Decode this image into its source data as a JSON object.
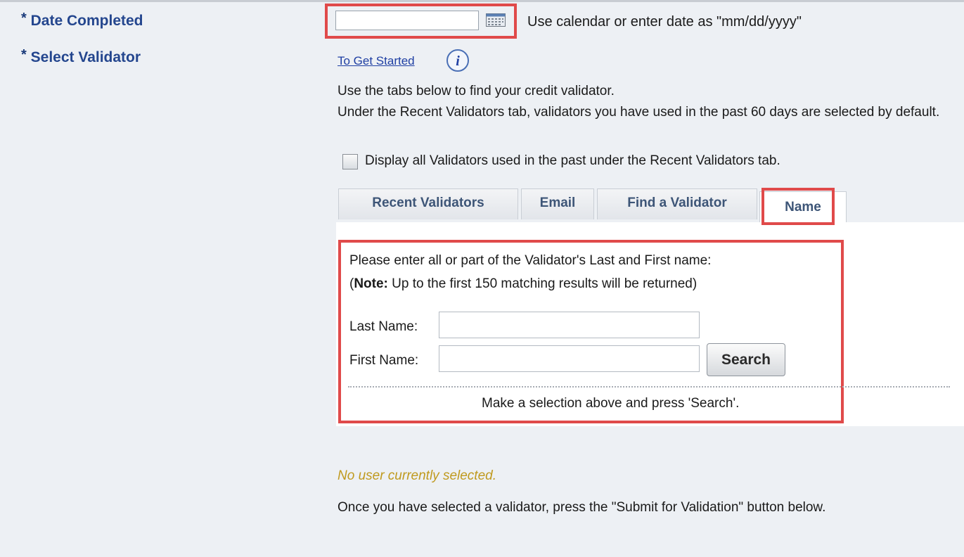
{
  "form": {
    "required_marker": "*",
    "date_completed_label": "Date Completed",
    "select_validator_label": "Select Validator",
    "date_value": "",
    "date_hint": "Use calendar or enter date as \"mm/dd/yyyy\""
  },
  "help": {
    "to_get_started": "To Get Started",
    "line1": "Use the tabs below to find your credit validator.",
    "line2": "Under the Recent Validators tab, validators you have used in the past 60 days are selected by default.",
    "checkbox_label": "Display all Validators used in the past under the Recent Validators tab.",
    "checkbox_checked": false
  },
  "tabs": [
    {
      "label": "Recent Validators",
      "active": false
    },
    {
      "label": "Email",
      "active": false
    },
    {
      "label": "Find a Validator",
      "active": false
    },
    {
      "label": "Name",
      "active": true
    }
  ],
  "name_search": {
    "instruction": "Please enter all or part of the Validator's Last and First name:",
    "note_prefix": "(",
    "note_bold": "Note:",
    "note_rest": " Up to the first 150 matching results will be returned)",
    "last_name_label": "Last Name:",
    "first_name_label": "First Name:",
    "last_name_value": "",
    "first_name_value": "",
    "search_button": "Search",
    "selection_message": "Make a selection above and press 'Search'."
  },
  "status": {
    "no_user": "No user currently selected.",
    "once_selected": "Once you have selected a validator, press the \"Submit for Validation\" button below."
  },
  "colors": {
    "highlight": "#e04a4a",
    "label_blue": "#24468e",
    "warning_text": "#c09a1f"
  }
}
